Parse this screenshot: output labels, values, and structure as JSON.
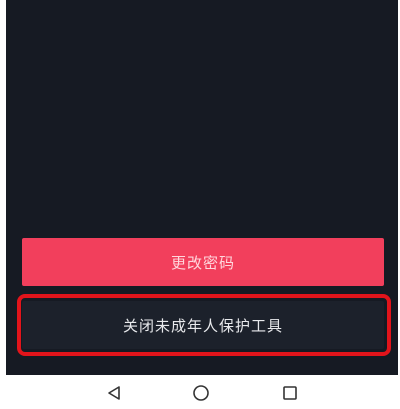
{
  "actions": {
    "change_password_label": "更改密码",
    "close_minor_protection_label": "关闭未成年人保护工具"
  },
  "nav_bar": {
    "back_icon": "triangle-back-icon",
    "home_icon": "circle-home-icon",
    "recents_icon": "square-recents-icon"
  },
  "colors": {
    "background": "#161a23",
    "primary_button": "#f23f5c",
    "secondary_button": "#1c212b",
    "highlight": "#e2141b"
  }
}
